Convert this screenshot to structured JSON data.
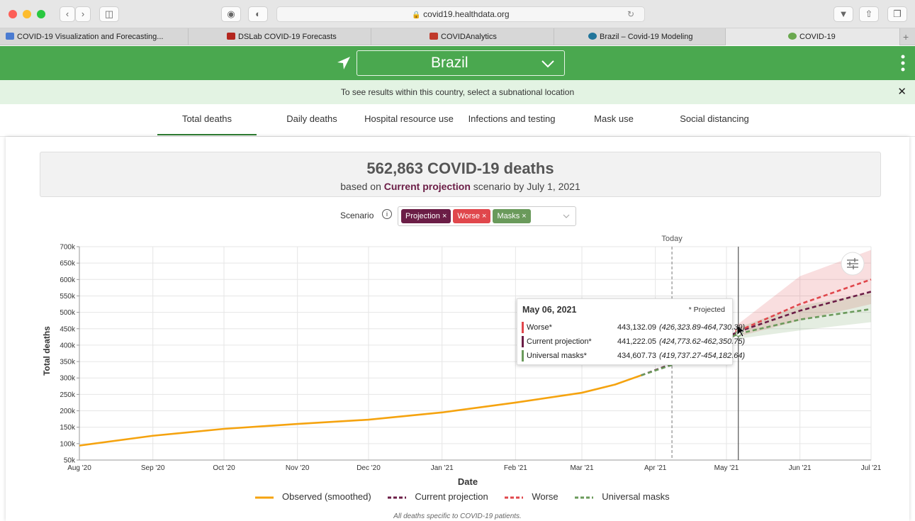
{
  "browser": {
    "url": "covid19.healthdata.org",
    "tabs": [
      {
        "label": "COVID-19 Visualization and Forecasting...",
        "color": "#4a7bd1"
      },
      {
        "label": "DSLab COVID-19 Forecasts",
        "color": "#b3261e"
      },
      {
        "label": "COVIDAnalytics",
        "color": "#c0392b"
      },
      {
        "label": "Brazil – Covid-19 Modeling",
        "color": "#21759b"
      },
      {
        "label": "COVID-19",
        "color": "#6aa84f"
      }
    ]
  },
  "header": {
    "location": "Brazil"
  },
  "notice": "To see results within this country, select a subnational location",
  "nav": [
    "Total deaths",
    "Daily deaths",
    "Hospital resource use",
    "Infections and testing",
    "Mask use",
    "Social distancing"
  ],
  "summary": {
    "title": "562,863 COVID-19 deaths",
    "sub_pre": "based on",
    "sub_bold": "Current projection",
    "sub_post": "scenario by July 1, 2021"
  },
  "scenario": {
    "label": "Scenario",
    "chips": [
      {
        "label": "Projection ×",
        "color": "#6b1d46"
      },
      {
        "label": "Worse ×",
        "color": "#e0474c"
      },
      {
        "label": "Masks ×",
        "color": "#6a9a5b"
      }
    ]
  },
  "colors": {
    "observed": "#f5a30f",
    "current": "#6b1d46",
    "worse": "#e0474c",
    "masks": "#6a9a5b",
    "green": "#4aa84f"
  },
  "chart_data": {
    "type": "line",
    "xlabel": "Date",
    "ylabel": "Total deaths",
    "ylim": [
      50000,
      700000
    ],
    "xlim": [
      "2020-08-01",
      "2021-07-01"
    ],
    "x_ticks": [
      "Aug '20",
      "Sep '20",
      "Oct '20",
      "Nov '20",
      "Dec '20",
      "Jan '21",
      "Feb '21",
      "Mar '21",
      "Apr '21",
      "May '21",
      "Jun '21",
      "Jul '21"
    ],
    "y_ticks": [
      "50k",
      "100k",
      "150k",
      "200k",
      "250k",
      "300k",
      "350k",
      "400k",
      "450k",
      "500k",
      "550k",
      "600k",
      "650k",
      "700k"
    ],
    "today_label": "Today",
    "today_date": "2021-04-08",
    "hover_date": "2021-05-06",
    "grid": true,
    "series": [
      {
        "name": "Observed (smoothed)",
        "style": "solid",
        "points": [
          [
            "2020-08-01",
            94000
          ],
          [
            "2020-09-01",
            124000
          ],
          [
            "2020-10-01",
            145000
          ],
          [
            "2020-11-01",
            160000
          ],
          [
            "2020-12-01",
            173000
          ],
          [
            "2021-01-01",
            195000
          ],
          [
            "2021-02-01",
            225000
          ],
          [
            "2021-03-01",
            255000
          ],
          [
            "2021-03-15",
            280000
          ],
          [
            "2021-03-26",
            308000
          ]
        ]
      },
      {
        "name": "Current projection",
        "style": "dashed",
        "points": [
          [
            "2021-03-26",
            308000
          ],
          [
            "2021-04-08",
            343000
          ],
          [
            "2021-05-06",
            441222
          ],
          [
            "2021-06-01",
            505000
          ],
          [
            "2021-07-01",
            562863
          ]
        ]
      },
      {
        "name": "Worse",
        "style": "dashed",
        "points": [
          [
            "2021-05-06",
            443132
          ],
          [
            "2021-06-01",
            525000
          ],
          [
            "2021-07-01",
            600000
          ]
        ]
      },
      {
        "name": "Universal masks",
        "style": "dashed",
        "points": [
          [
            "2021-03-26",
            308000
          ],
          [
            "2021-04-08",
            340000
          ],
          [
            "2021-05-06",
            434608
          ],
          [
            "2021-06-01",
            478000
          ],
          [
            "2021-07-01",
            510000
          ]
        ]
      }
    ],
    "bands": [
      {
        "series": "Worse",
        "lower": [
          [
            "2021-05-06",
            426324
          ],
          [
            "2021-06-01",
            475000
          ],
          [
            "2021-07-01",
            525000
          ]
        ],
        "upper": [
          [
            "2021-05-06",
            464730
          ],
          [
            "2021-06-01",
            610000
          ],
          [
            "2021-07-01",
            690000
          ]
        ]
      },
      {
        "series": "Universal masks",
        "lower": [
          [
            "2021-05-06",
            419737
          ],
          [
            "2021-06-01",
            445000
          ],
          [
            "2021-07-01",
            470000
          ]
        ],
        "upper": [
          [
            "2021-05-06",
            454183
          ],
          [
            "2021-06-01",
            520000
          ],
          [
            "2021-07-01",
            560000
          ]
        ]
      }
    ]
  },
  "tooltip": {
    "date": "May 06, 2021",
    "note": "* Projected",
    "rows": [
      {
        "name": "Worse*",
        "value": "443,132.09",
        "range": "(426,323.89-464,730.39)"
      },
      {
        "name": "Current projection*",
        "value": "441,222.05",
        "range": "(424,773.62-462,350.75)"
      },
      {
        "name": "Universal masks*",
        "value": "434,607.73",
        "range": "(419,737.27-454,182.64)"
      }
    ]
  },
  "legend": [
    "Observed (smoothed)",
    "Current projection",
    "Worse",
    "Universal masks"
  ],
  "footnote": "All deaths specific to COVID-19 patients."
}
